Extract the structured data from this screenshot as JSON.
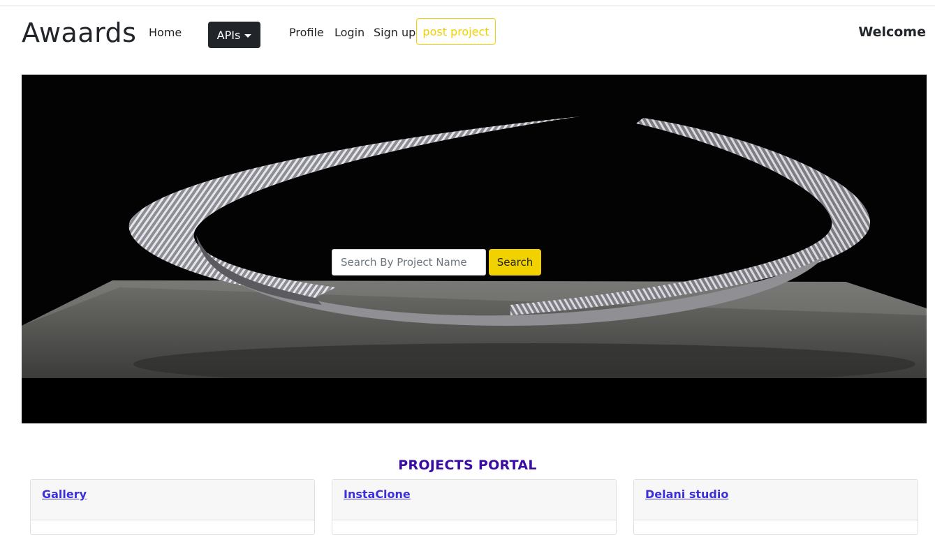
{
  "navbar": {
    "brand": "Awaards",
    "links": {
      "home": "Home",
      "profile": "Profile",
      "login": "Login",
      "signup": "Sign up"
    },
    "dropdown_label": "APIs",
    "post_project": "post project",
    "welcome": "Welcome"
  },
  "hero": {
    "search_placeholder": "Search By Project Name",
    "search_button": "Search"
  },
  "portal": {
    "title": "PROJECTS PORTAL",
    "cards": [
      {
        "title": "Gallery"
      },
      {
        "title": "InstaClone"
      },
      {
        "title": "Delani studio"
      }
    ]
  },
  "colors": {
    "accent": "#f2d100",
    "title": "#3a0ca3",
    "link": "#3c2fd8",
    "dark": "#212529"
  }
}
